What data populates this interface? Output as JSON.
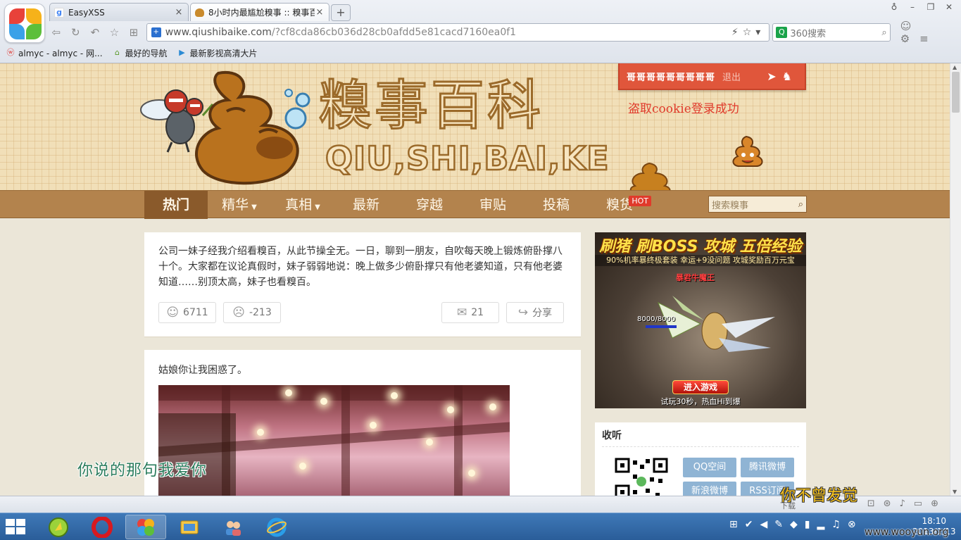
{
  "browser": {
    "tabs": [
      {
        "label": "EasyXSS",
        "icon": "google-favicon",
        "active": false
      },
      {
        "label": "8小时内最尴尬糗事 :: 糗事百",
        "icon": "poop-favicon",
        "active": true
      }
    ],
    "new_tab": "+",
    "address": {
      "host": "www.qiushibaike.com",
      "path": "/?cf8cda86cb036d28cb0afdd5e81cacd7160ea0f1"
    },
    "search": {
      "placeholder": "360搜索"
    },
    "bookmarks": [
      {
        "label": "almyc - almyc - 网...",
        "icon": "weibo-icon"
      },
      {
        "label": "最好的导航",
        "icon": "nav-icon"
      },
      {
        "label": "最新影视高清大片",
        "icon": "video-icon"
      }
    ]
  },
  "site": {
    "logo_cn": "糗事百科",
    "logo_en": "QIU,SHI,BAI,KE",
    "user": {
      "name": "哥哥哥哥哥哥哥哥哥",
      "logout": "退出"
    },
    "cookie_message": "盗取cookie登录成功",
    "nav": [
      {
        "label": "热门",
        "active": true,
        "caret": false
      },
      {
        "label": "精华",
        "active": false,
        "caret": true
      },
      {
        "label": "真相",
        "active": false,
        "caret": true
      },
      {
        "label": "最新",
        "active": false,
        "caret": false
      },
      {
        "label": "穿越",
        "active": false,
        "caret": false
      },
      {
        "label": "审贴",
        "active": false,
        "caret": false
      },
      {
        "label": "投稿",
        "active": false,
        "caret": false
      },
      {
        "label": "糗货",
        "active": false,
        "caret": false,
        "badge": "HOT"
      }
    ],
    "nav_search_placeholder": "搜索糗事"
  },
  "posts": [
    {
      "text": "公司一妹子经我介绍看糗百，从此节操全无。一日，聊到一朋友，自吹每天晚上锻炼俯卧撑八十个。大家都在议论真假时，妹子弱弱地说：晚上做多少俯卧撑只有他老婆知道，只有他老婆知道……别顶太高，妹子也看糗百。",
      "up": "6711",
      "down": "-213",
      "comments": "21",
      "share": "分享"
    },
    {
      "text": "姑娘你让我困惑了。"
    }
  ],
  "ad": {
    "headline": "刷猪 刷BOSS 攻城 五倍经验",
    "subline": "90%机率暴终极套装  幸运+9没问题  攻城奖励百万元宝",
    "boss_name": "暴君牛魔王",
    "hp": "8000/8000",
    "cta": "进入游戏",
    "footer": "试玩30秒，热血Hi到爆"
  },
  "follow": {
    "title": "收听",
    "buttons": [
      "QQ空间",
      "腾讯微博",
      "新浪微博",
      "RSS订阅"
    ]
  },
  "overlays": {
    "left": "你说的那句我爱你",
    "right": "你不曾发觉"
  },
  "statusbar": {
    "download": "下载"
  },
  "taskbar": {
    "time": "18:10",
    "date": "2013/1/13"
  },
  "watermark": "www.wooyun.org",
  "colors": {
    "nav_bg": "#b3834d",
    "userbar_bg": "#e0563b",
    "cookie_text": "#e03a2b",
    "hot_badge": "#e03a2b"
  }
}
